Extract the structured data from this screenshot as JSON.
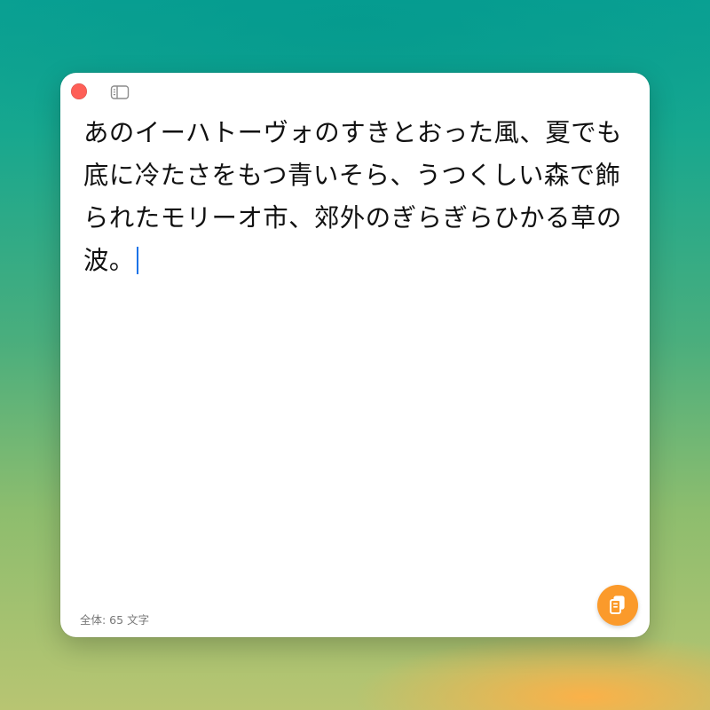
{
  "editor": {
    "text": "あのイーハトーヴォのすきとおった風、夏でも底に冷たさをもつ青いそら、うつくしい森で飾られたモリーオ市、郊外のぎらぎらひかる草の波。"
  },
  "status": {
    "count_label": "全体: 65 文字"
  },
  "icons": {
    "close": "close-icon",
    "sidebar": "sidebar-icon",
    "copy": "copy-icon"
  },
  "colors": {
    "close": "#fe5f57",
    "caret": "#1a73e8",
    "copy_button": "#fb9a2b"
  }
}
